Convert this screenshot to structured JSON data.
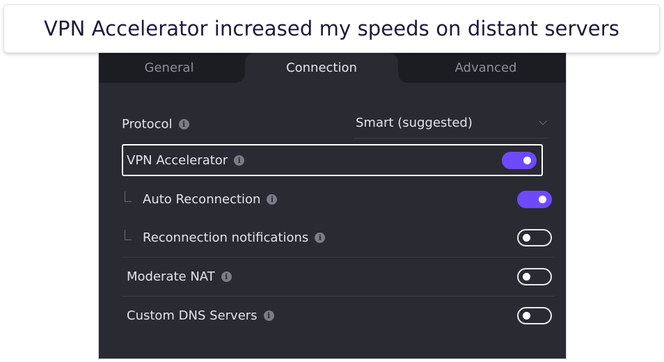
{
  "caption": "VPN Accelerator increased my speeds on distant servers",
  "tabs": {
    "general": "General",
    "connection": "Connection",
    "advanced": "Advanced"
  },
  "settings": {
    "protocol": {
      "label": "Protocol",
      "value": "Smart (suggested)"
    },
    "vpn_accelerator": {
      "label": "VPN Accelerator",
      "enabled": true
    },
    "auto_reconnection": {
      "label": "Auto Reconnection",
      "enabled": true
    },
    "reconnection_notifications": {
      "label": "Reconnection notifications",
      "enabled": false
    },
    "moderate_nat": {
      "label": "Moderate NAT",
      "enabled": false
    },
    "custom_dns": {
      "label": "Custom DNS Servers",
      "enabled": false
    }
  },
  "icons": {
    "info": "info-icon",
    "chevron": "chevron-down-icon",
    "connector": "sub-setting-connector-icon"
  },
  "colors": {
    "accent": "#6d4aff",
    "panel_bg": "#2a2a33",
    "tabbar_bg": "#1c1c23",
    "text_primary": "#e4e4ea",
    "text_muted": "#8e8e99"
  }
}
